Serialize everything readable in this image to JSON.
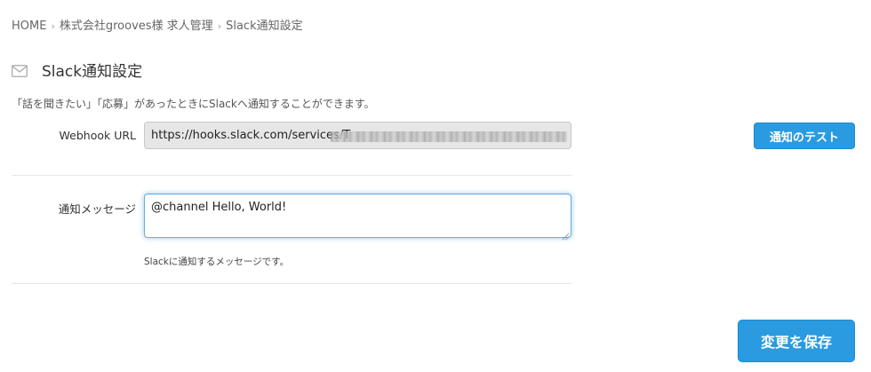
{
  "breadcrumb": {
    "items": [
      {
        "label": "HOME"
      },
      {
        "label": "株式会社grooves様 求人管理"
      },
      {
        "label": "Slack通知設定"
      }
    ],
    "separator": "›"
  },
  "header": {
    "icon": "envelope-icon",
    "title": "Slack通知設定"
  },
  "description": "「話を聞きたい」「応募」があったときにSlackへ通知することができます。",
  "webhook": {
    "label": "Webhook URL",
    "value": "https://hooks.slack.com/services/T"
  },
  "test_button": {
    "label": "通知のテスト"
  },
  "message": {
    "label": "通知メッセージ",
    "value": "@channel Hello, World!",
    "help": "Slackに通知するメッセージです。"
  },
  "save_button": {
    "label": "変更を保存"
  },
  "colors": {
    "primary_button": "#2a9be0",
    "focus_border": "#66afe9",
    "disabled_input_bg": "#e6e6e6"
  }
}
